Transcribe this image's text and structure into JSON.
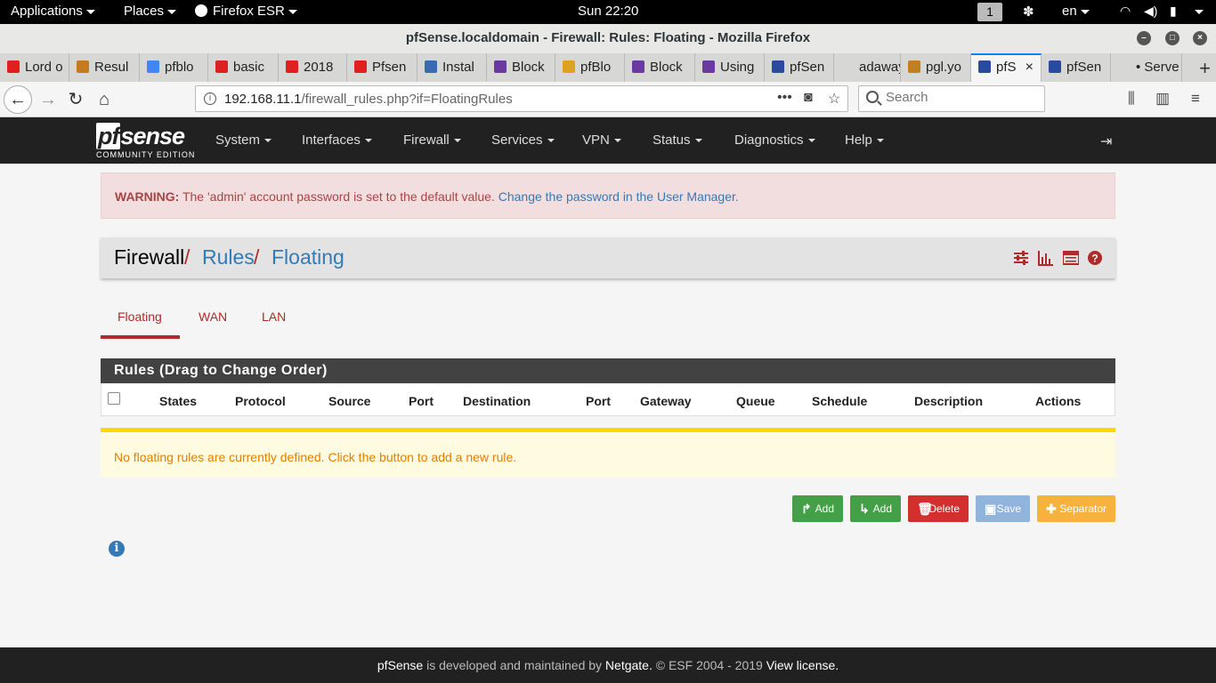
{
  "gnome": {
    "applications": "Applications",
    "places": "Places",
    "firefox": "Firefox ESR",
    "clock": "Sun 22:20",
    "workspace": "1",
    "lang": "en"
  },
  "window": {
    "title": "pfSense.localdomain - Firewall: Rules: Floating - Mozilla Firefox"
  },
  "tabs": [
    {
      "label": "Lord o",
      "color": "#e02020"
    },
    {
      "label": "Resul",
      "color": "#c47a1f"
    },
    {
      "label": "pfblo",
      "color": "#4285f4"
    },
    {
      "label": "basic",
      "color": "#e02020"
    },
    {
      "label": "2018",
      "color": "#e02020"
    },
    {
      "label": "Pfsen",
      "color": "#e02020"
    },
    {
      "label": "Instal",
      "color": "#3a6ab0"
    },
    {
      "label": "Block",
      "color": "#6a3aa0"
    },
    {
      "label": "pfBlo",
      "color": "#e0a020"
    },
    {
      "label": "Block",
      "color": "#6a3aa0"
    },
    {
      "label": "Using",
      "color": "#6a3aa0"
    },
    {
      "label": "pfSen",
      "color": "#2a4aa0"
    },
    {
      "label": "adaway.",
      "color": "#d7d7d6"
    },
    {
      "label": "pgl.yo",
      "color": "#c08020"
    },
    {
      "label": "pfS",
      "color": "#2a4aa0"
    },
    {
      "label": "pfSen",
      "color": "#2a4aa0"
    },
    {
      "label": "• Serve",
      "color": "#d7d7d6"
    }
  ],
  "nav": {
    "url_host": "192.168.11.1",
    "url_path": "/firewall_rules.php?if=FloatingRules",
    "search_placeholder": "Search"
  },
  "pf": {
    "brand": "sense",
    "brand_prefix": "pf",
    "edition": "COMMUNITY EDITION",
    "menu": [
      "System",
      "Interfaces",
      "Firewall",
      "Services",
      "VPN",
      "Status",
      "Diagnostics",
      "Help"
    ]
  },
  "warning": {
    "label": "WARNING:",
    "text": " The 'admin' account password is set to the default value. ",
    "link": "Change the password in the User Manager."
  },
  "breadcrumb": {
    "root": "Firewall",
    "sep": "/",
    "level1": "Rules",
    "level2": "Floating"
  },
  "subtabs": [
    "Floating",
    "WAN",
    "LAN"
  ],
  "rules": {
    "panel_title": "Rules (Drag to Change Order)",
    "columns": [
      "States",
      "Protocol",
      "Source",
      "Port",
      "Destination",
      "Port",
      "Gateway",
      "Queue",
      "Schedule",
      "Description",
      "Actions"
    ],
    "empty_notice": "No floating rules are currently defined. Click the button to add a new rule."
  },
  "actions": {
    "add_top": "Add",
    "add_bottom": "Add",
    "delete": "Delete",
    "save": "Save",
    "separator": "Separator"
  },
  "footer": {
    "pfsense": "pfSense",
    "text1": " is developed and maintained by ",
    "netgate": "Netgate.",
    "text2": " © ESF 2004 - 2019 ",
    "license": "View license."
  },
  "colors": {
    "brand_red": "#b02a2a",
    "link_blue": "#337ab7",
    "header_dark": "#212121",
    "notice_orange": "#e67e00"
  }
}
